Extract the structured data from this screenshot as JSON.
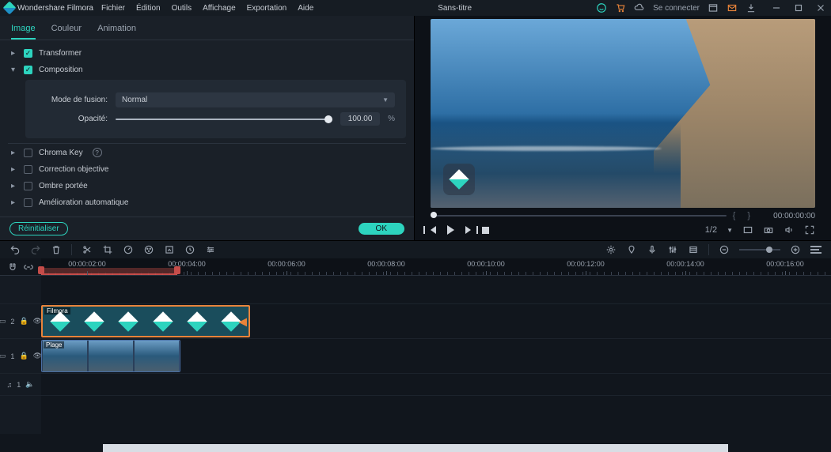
{
  "app": {
    "name": "Wondershare Filmora",
    "title": "Sans-titre"
  },
  "menu": [
    "Fichier",
    "Édition",
    "Outils",
    "Affichage",
    "Exportation",
    "Aide"
  ],
  "titlebar": {
    "signin": "Se connecter"
  },
  "tabs": [
    "Image",
    "Couleur",
    "Animation"
  ],
  "tabs_active": 0,
  "props": {
    "transformer": "Transformer",
    "composition": "Composition",
    "blend_label": "Mode de fusion:",
    "blend_value": "Normal",
    "opacity_label": "Opacité:",
    "opacity_value": "100.00",
    "opacity_unit": "%",
    "chroma": "Chroma Key",
    "correction": "Correction objective",
    "shadow": "Ombre portée",
    "auto": "Amélioration automatique"
  },
  "buttons": {
    "reset": "Réinitialiser",
    "ok": "OK"
  },
  "preview": {
    "timecode": "00:00:00:00",
    "page": "1/2"
  },
  "timeline": {
    "ticks": [
      "00:00:02:00",
      "00:00:04:00",
      "00:00:06:00",
      "00:00:08:00",
      "00:00:10:00",
      "00:00:12:00",
      "00:00:14:00",
      "00:00:16:00"
    ],
    "tracks": [
      {
        "id": "track-v2",
        "head_icon": "picture",
        "head_label": "2",
        "lock": true,
        "eye": true
      },
      {
        "id": "track-v1",
        "head_icon": "picture",
        "head_label": "1",
        "lock": true,
        "eye": true
      },
      {
        "id": "track-a1",
        "head_icon": "music",
        "head_label": "1",
        "mute": true
      }
    ],
    "clip1_label": "Filmora",
    "clip2_label": "Plage"
  }
}
